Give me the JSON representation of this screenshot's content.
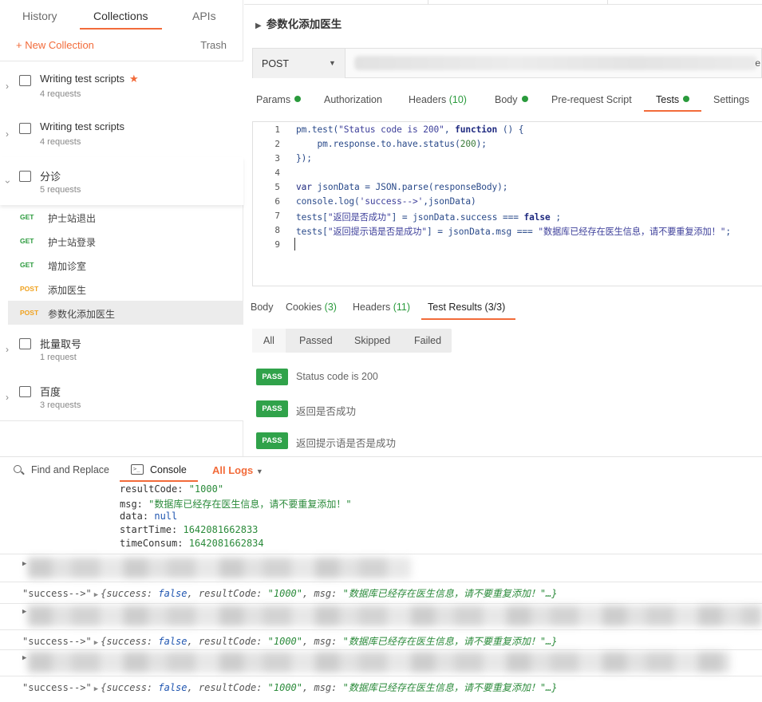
{
  "sidebar": {
    "tabs": [
      "History",
      "Collections",
      "APIs"
    ],
    "new_collection": "+ New Collection",
    "trash": "Trash",
    "collections": [
      {
        "name": "Writing test scripts",
        "sub": "4 requests",
        "star": "★"
      },
      {
        "name": "Writing test scripts",
        "sub": "4 requests"
      },
      {
        "name": "分诊",
        "sub": "5 requests"
      },
      {
        "name": "批量取号",
        "sub": "1 request"
      },
      {
        "name": "百度",
        "sub": "3 requests"
      }
    ],
    "requests": [
      {
        "method": "GET",
        "name": "护士站退出"
      },
      {
        "method": "GET",
        "name": "护士站登录"
      },
      {
        "method": "GET",
        "name": "增加诊室"
      },
      {
        "method": "POST",
        "name": "添加医生"
      },
      {
        "method": "POST",
        "name": "参数化添加医生"
      }
    ]
  },
  "main": {
    "breadcrumb": "参数化添加医生",
    "method": "POST",
    "url_tail": "e",
    "request_tabs": [
      "Params",
      "Authorization",
      "Headers",
      "(10)",
      "Body",
      "Pre-request Script",
      "Tests",
      "Settings"
    ],
    "code_lines": [
      "1",
      "2",
      "3",
      "4",
      "5",
      "6",
      "7",
      "8",
      "9"
    ],
    "code": {
      "l1a": "pm.test(",
      "l1b": "\"Status code is 200\"",
      "l1c": ", ",
      "l1d": "function",
      "l1e": " () {",
      "l2a": "    pm.response.to.have.status(",
      "l2b": "200",
      "l2c": ");",
      "l3": "});",
      "l5a": "var",
      "l5b": " jsonData = JSON.parse(responseBody);",
      "l6a": "console.log(",
      "l6b": "'success-->'",
      "l6c": ",jsonData)",
      "l7a": "tests[",
      "l7b": "\"返回是否成功\"",
      "l7c": "] = jsonData.success === ",
      "l7d": "false",
      "l7e": " ;",
      "l8a": "tests[",
      "l8b": "\"返回提示语是否是成功\"",
      "l8c": "] = jsonData.msg === ",
      "l8d": "\"数据库已经存在医生信息，请不要重复添加！\"",
      "l8e": ";"
    },
    "response_tabs": [
      "Body",
      "Cookies",
      "(3)",
      "Headers",
      "(11)",
      "Test Results (3/3)"
    ],
    "filters": [
      "All",
      "Passed",
      "Skipped",
      "Failed"
    ],
    "results": [
      {
        "badge": "PASS",
        "text": "Status code is 200"
      },
      {
        "badge": "PASS",
        "text": "返回是否成功"
      },
      {
        "badge": "PASS",
        "text": "返回提示语是否是成功"
      }
    ]
  },
  "console": {
    "find_replace": "Find and Replace",
    "console_label": "Console",
    "term_glyph": ">_",
    "all_logs": "All Logs",
    "kv": [
      {
        "k": "resultCode: ",
        "v": "\"1000\""
      },
      {
        "k": "msg: ",
        "v": "\"数据库已经存在医生信息，请不要重复添加！\""
      },
      {
        "k": "data: ",
        "v": "null"
      },
      {
        "k": "startTime: ",
        "v": "1642081662833"
      },
      {
        "k": "timeConsum: ",
        "v": "1642081662834"
      }
    ],
    "success_label": "\"success-->\"",
    "success_obj": {
      "p1": "{success: ",
      "p2": "false",
      "p3": ", resultCode: ",
      "p4": "\"1000\"",
      "p5": ", msg: ",
      "p6": "\"数据库已经存在医生信息，请不要重复添加！\"…}"
    }
  }
}
